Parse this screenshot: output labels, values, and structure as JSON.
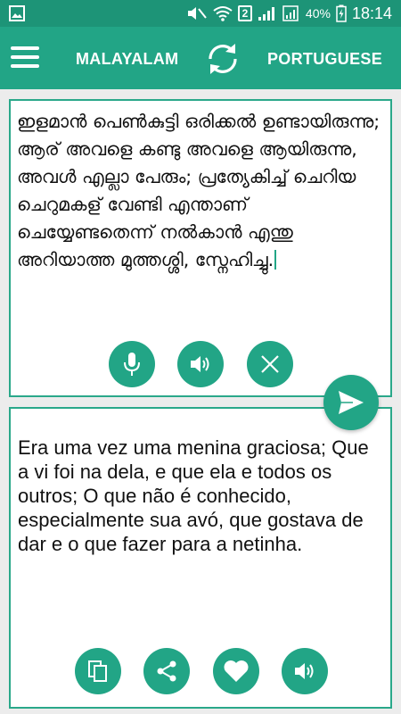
{
  "status_bar": {
    "battery": "40%",
    "time": "18:14",
    "sim_badge": "2",
    "icons": [
      "gallery-icon",
      "mute-icon",
      "wifi-icon",
      "signal-icon",
      "battery-icon"
    ]
  },
  "app_bar": {
    "source_language": "MALAYALAM",
    "target_language": "PORTUGUESE",
    "icons": [
      "menu-icon",
      "swap-icon"
    ]
  },
  "source_panel": {
    "text": "ഇളമാൻ പെൺകുട്ടി ഒരിക്കൽ ഉണ്ടായിരുന്നു; ആര് അവളെ കണ്ടു അവളെ ആയിരുന്നു, അവൾ എല്ലാ പേരും; പ്രത്യേകിച്ച് ചെറിയ ചെറുമകള് വേണ്ടി എന്താണ് ചെയ്യേണ്ടതെന്ന് നൽകാൻ എന്തു അറിയാത്ത മുത്തശ്ശി, സ്നേഹിച്ചു.",
    "buttons": [
      "mic-icon",
      "speaker-icon",
      "clear-icon"
    ]
  },
  "send_button": {
    "icon": "send-icon"
  },
  "target_panel": {
    "text": "Era uma vez uma menina graciosa; Que a vi foi na dela, e que ela e todos os outros; O que não é conhecido, especialmente sua avó, que gostava de dar e o que fazer para a netinha.",
    "buttons": [
      "copy-icon",
      "share-icon",
      "heart-icon",
      "speaker-icon"
    ]
  },
  "colors": {
    "status_bar": "#1d9477",
    "app_bar": "#22a586",
    "accent": "#22a586",
    "panel_border": "#2aa88a",
    "background": "#ececec"
  }
}
